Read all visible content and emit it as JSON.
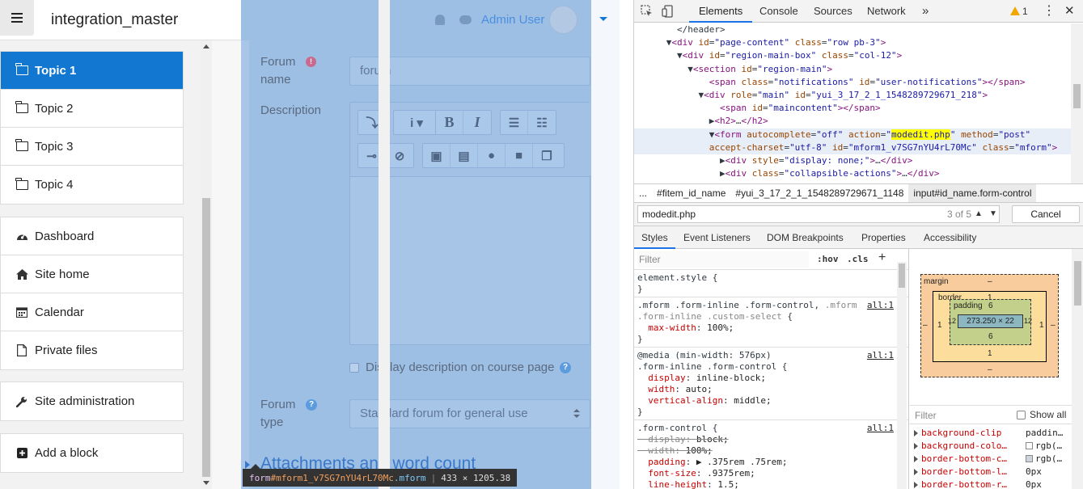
{
  "moodle": {
    "site_title": "integration_master",
    "menu_icon": "hamburger-icon",
    "user_name": "Admin User",
    "nav_sections": [
      {
        "label": "Topic 1",
        "icon": "folder-icon",
        "active": true
      },
      {
        "label": "Topic 2",
        "icon": "folder-icon"
      },
      {
        "label": "Topic 3",
        "icon": "folder-icon"
      },
      {
        "label": "Topic 4",
        "icon": "folder-icon"
      }
    ],
    "nav_main": [
      {
        "label": "Dashboard",
        "icon": "dashboard-icon"
      },
      {
        "label": "Site home",
        "icon": "home-icon"
      },
      {
        "label": "Calendar",
        "icon": "calendar-icon"
      },
      {
        "label": "Private files",
        "icon": "file-icon"
      }
    ],
    "site_admin": {
      "label": "Site administration",
      "icon": "wrench-icon"
    },
    "add_block": {
      "label": "Add a block",
      "icon": "plus-square-icon"
    },
    "form": {
      "forum_name_label": "Forum name",
      "forum_name_value": "forum",
      "description_label": "Description",
      "display_description_label": "Display description on course page",
      "forum_type_label": "Forum type",
      "forum_type_value": "Standard forum for general use",
      "attachments_heading": "Attachments and word count"
    },
    "tooltip": {
      "tag": "form",
      "id": "#mform1_v7SG7nYU4rL70Mc",
      "class": ".mform",
      "size": "433 × 1205.38"
    }
  },
  "devtools": {
    "tabs": [
      "Elements",
      "Console",
      "Sources",
      "Network"
    ],
    "active_tab": "Elements",
    "more_tabs": "»",
    "warning_count": "1",
    "dom_lines": [
      {
        "html": "        &lt;/header&gt;"
      },
      {
        "html": "      ▼<span class='t'>&lt;div</span> <span class='a'>id</span>=<span class='v'>\"page-content\"</span> <span class='a'>class</span>=<span class='v'>\"row pb-3\"</span><span class='t'>&gt;</span>"
      },
      {
        "html": "        ▼<span class='t'>&lt;div</span> <span class='a'>id</span>=<span class='v'>\"region-main-box\"</span> <span class='a'>class</span>=<span class='v'>\"col-12\"</span><span class='t'>&gt;</span>"
      },
      {
        "html": "          ▼<span class='t'>&lt;section</span> <span class='a'>id</span>=<span class='v'>\"region-main\"</span><span class='t'>&gt;</span>"
      },
      {
        "html": "              <span class='t'>&lt;span</span> <span class='a'>class</span>=<span class='v'>\"notifications\"</span> <span class='a'>id</span>=<span class='v'>\"user-notifications\"</span><span class='t'>&gt;&lt;/span&gt;</span>"
      },
      {
        "html": "            ▼<span class='t'>&lt;div</span> <span class='a'>role</span>=<span class='v'>\"main\"</span> <span class='a'>id</span>=<span class='v'>\"yui_3_17_2_1_1548289729671_218\"</span><span class='t'>&gt;</span>"
      },
      {
        "html": "                <span class='t'>&lt;span</span> <span class='a'>id</span>=<span class='v'>\"maincontent\"</span><span class='t'>&gt;&lt;/span&gt;</span>"
      },
      {
        "html": "              ▶<span class='t'>&lt;h2&gt;</span>…<span class='t'>&lt;/h2&gt;</span>"
      },
      {
        "html": "              ▼<span class='t'>&lt;form</span> <span class='a'>autocomplete</span>=<span class='v'>\"off\"</span> <span class='a'>action</span>=<span class='v'>\"<span class='hl'>modedit.php</span>\"</span> <span class='a'>method</span>=<span class='v'>\"post\"</span>",
        "sel": true
      },
      {
        "html": "              <span class='a'>accept-charset</span>=<span class='v'>\"utf-8\"</span> <span class='a'>id</span>=<span class='v'>\"mform1_v7SG7nYU4rL70Mc\"</span> <span class='a'>class</span>=<span class='v'>\"mform\"</span><span class='t'>&gt;</span>",
        "sel": true
      },
      {
        "html": "                ▶<span class='t'>&lt;div</span> <span class='a'>style</span>=<span class='v'>\"display: none;\"</span><span class='t'>&gt;</span>…<span class='t'>&lt;/div&gt;</span>"
      },
      {
        "html": "                ▶<span class='t'>&lt;div</span> <span class='a'>class</span>=<span class='v'>\"collapsible-actions\"</span><span class='t'>&gt;</span>…<span class='t'>&lt;/div&gt;</span>"
      }
    ],
    "breadcrumbs": [
      "...",
      "#fitem_id_name",
      "#yui_3_17_2_1_1548289729671_1148",
      "input#id_name.form-control"
    ],
    "search": {
      "value": "modedit.php",
      "count": "3 of 5",
      "cancel": "Cancel"
    },
    "sub_tabs": [
      "Styles",
      "Event Listeners",
      "DOM Breakpoints",
      "Properties",
      "Accessibility"
    ],
    "styles_filter_placeholder": "Filter",
    "hov": ":hov",
    "cls": ".cls",
    "rules": [
      {
        "selector": "element.style {",
        "close": "}",
        "props": []
      },
      {
        "selector_html": ".mform .form-inline .form-control, <span class='sel-grey'>.mform</span>",
        "selector2_html": "<span class='sel-grey'>.form-inline .custom-select</span> {",
        "source": "all:1",
        "props": [
          {
            "name": "max-width",
            "value": "100%;"
          }
        ],
        "close": "}"
      },
      {
        "media": "@media (min-width: 576px)",
        "selector": ".form-inline .form-control {",
        "source": "all:1",
        "props": [
          {
            "name": "display",
            "value": "inline-block;"
          },
          {
            "name": "width",
            "value": "auto;"
          },
          {
            "name": "vertical-align",
            "value": "middle;"
          }
        ],
        "close": "}"
      },
      {
        "selector": ".form-control {",
        "source": "all:1",
        "props": [
          {
            "name": "display",
            "value": "block;",
            "strike": true
          },
          {
            "name": "width",
            "value": "100%;",
            "strike": true
          },
          {
            "name": "padding",
            "value": "▶ .375rem .75rem;"
          },
          {
            "name": "font-size",
            "value": ".9375rem;"
          },
          {
            "name": "line-height",
            "value": "1.5;"
          }
        ]
      }
    ],
    "box_model": {
      "margin_label": "margin",
      "margin": {
        "top": "–",
        "bottom": "–",
        "left": "–",
        "right": "–"
      },
      "border_label": "border",
      "border": {
        "top": "1",
        "bottom": "1",
        "left": "1",
        "right": "1"
      },
      "padding_label": "padding",
      "padding": {
        "top": "6",
        "bottom": "6",
        "left": "12",
        "right": "12"
      },
      "content": "273.250 × 22"
    },
    "computed_filter_placeholder": "Filter",
    "show_all": "Show all",
    "computed": [
      {
        "name": "background-clip",
        "value": "paddin…"
      },
      {
        "name": "background-colo…",
        "value": "rgb(…",
        "swatch": "#ffffff"
      },
      {
        "name": "border-bottom-c…",
        "value": "rgb(…",
        "swatch": "#ced4da"
      },
      {
        "name": "border-bottom-l…",
        "value": "0px"
      },
      {
        "name": "border-bottom-r…",
        "value": "0px"
      }
    ]
  }
}
